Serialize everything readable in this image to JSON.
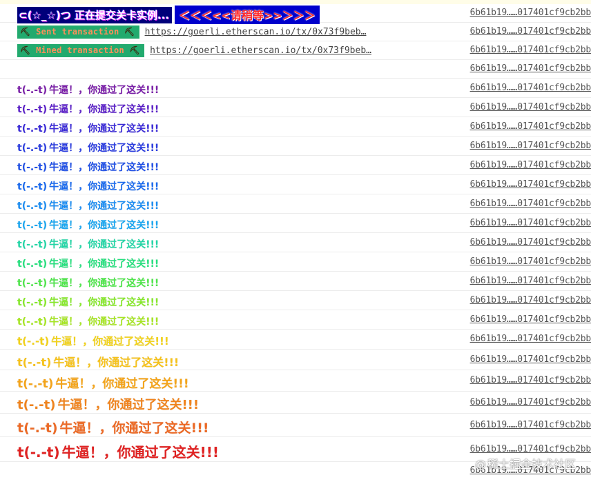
{
  "banner": {
    "part1": "⊂(☆_☆)つ 正在提交关卡实例...",
    "part2": "＜＜＜<<请稍等>>＞＞＞",
    "source": "6b61b19……017401cf9cb2bb"
  },
  "tx_rows": [
    {
      "label": "Sent transaction",
      "pick": "⛏",
      "url": "https://goerli.etherscan.io/tx/0x73f9beb…",
      "source": "6b61b19……017401cf9cb2bb"
    },
    {
      "label": "Mined transaction",
      "pick": "⛏",
      "url": "https://goerli.etherscan.io/tx/0x73f9beb…",
      "source": "6b61b19……017401cf9cb2bb"
    }
  ],
  "empty_row": {
    "source": "6b61b19……017401cf9cb2bb"
  },
  "success_rows": [
    {
      "face": "t(-.-t)",
      "text": "牛逼！，你通过了这关!!!",
      "color": "#7a1fa8",
      "source": "6b61b19……017401cf9cb2bb"
    },
    {
      "face": "t(-.-t)",
      "text": "牛逼！，你通过了这关!!!",
      "color": "#5a1fc8",
      "source": "6b61b19……017401cf9cb2bb"
    },
    {
      "face": "t(-.-t)",
      "text": "牛逼！，你通过了这关!!!",
      "color": "#3a2ad8",
      "source": "6b61b19……017401cf9cb2bb"
    },
    {
      "face": "t(-.-t)",
      "text": "牛逼！，你通过了这关!!!",
      "color": "#2a3ce0",
      "source": "6b61b19……017401cf9cb2bb"
    },
    {
      "face": "t(-.-t)",
      "text": "牛逼！，你通过了这关!!!",
      "color": "#2050e6",
      "source": "6b61b19……017401cf9cb2bb"
    },
    {
      "face": "t(-.-t)",
      "text": "牛逼！，你通过了这关!!!",
      "color": "#1a6aee",
      "source": "6b61b19……017401cf9cb2bb"
    },
    {
      "face": "t(-.-t)",
      "text": "牛逼！，你通过了这关!!!",
      "color": "#1a8cf2",
      "source": "6b61b19……017401cf9cb2bb"
    },
    {
      "face": "t(-.-t)",
      "text": "牛逼！，你通过了这关!!!",
      "color": "#1aa6f0",
      "source": "6b61b19……017401cf9cb2bb"
    },
    {
      "face": "t(-.-t)",
      "text": "牛逼！，你通过了这关!!!",
      "color": "#22d6a6",
      "source": "6b61b19……017401cf9cb2bb"
    },
    {
      "face": "t(-.-t)",
      "text": "牛逼！，你通过了这关!!!",
      "color": "#26e07e",
      "source": "6b61b19……017401cf9cb2bb"
    },
    {
      "face": "t(-.-t)",
      "text": "牛逼！，你通过了这关!!!",
      "color": "#4ee64a",
      "source": "6b61b19……017401cf9cb2bb"
    },
    {
      "face": "t(-.-t)",
      "text": "牛逼！，你通过了这关!!!",
      "color": "#86e82a",
      "source": "6b61b19……017401cf9cb2bb"
    },
    {
      "face": "t(-.-t)",
      "text": "牛逼！，你通过了这关!!!",
      "color": "#a6e622",
      "source": "6b61b19……017401cf9cb2bb"
    },
    {
      "face": "t(-.-t)",
      "text": "牛逼！，你通过了这关!!!",
      "color": "#f2d21a",
      "source": "6b61b19……017401cf9cb2bb"
    },
    {
      "face": "t(-.-t)",
      "text": "牛逼！，你通过了这关!!!",
      "color": "#f6c21a",
      "source": "6b61b19……017401cf9cb2bb"
    },
    {
      "face": "t(-.-t)",
      "text": "牛逼！，你通过了这关!!!",
      "color": "#f4a41a",
      "source": "6b61b19……017401cf9cb2bb"
    },
    {
      "face": "t(-.-t)",
      "text": "牛逼！，你通过了这关!!!",
      "color": "#f0841e",
      "source": "6b61b19……017401cf9cb2bb"
    },
    {
      "face": "t(-.-t)",
      "text": "牛逼！，你通过了这关!!!",
      "color": "#ec6a26",
      "source": "6b61b19……017401cf9cb2bb"
    },
    {
      "face": "t(-.-t)",
      "text": "牛逼！，你通过了这关!!!",
      "color": "#e02222",
      "source": "6b61b19……017401cf9cb2bb"
    }
  ],
  "last_row": {
    "source": "6b61b19……017401cf9cb2bb"
  },
  "watermark": {
    "at": "@",
    "text": "稀土掘金技术社区"
  }
}
